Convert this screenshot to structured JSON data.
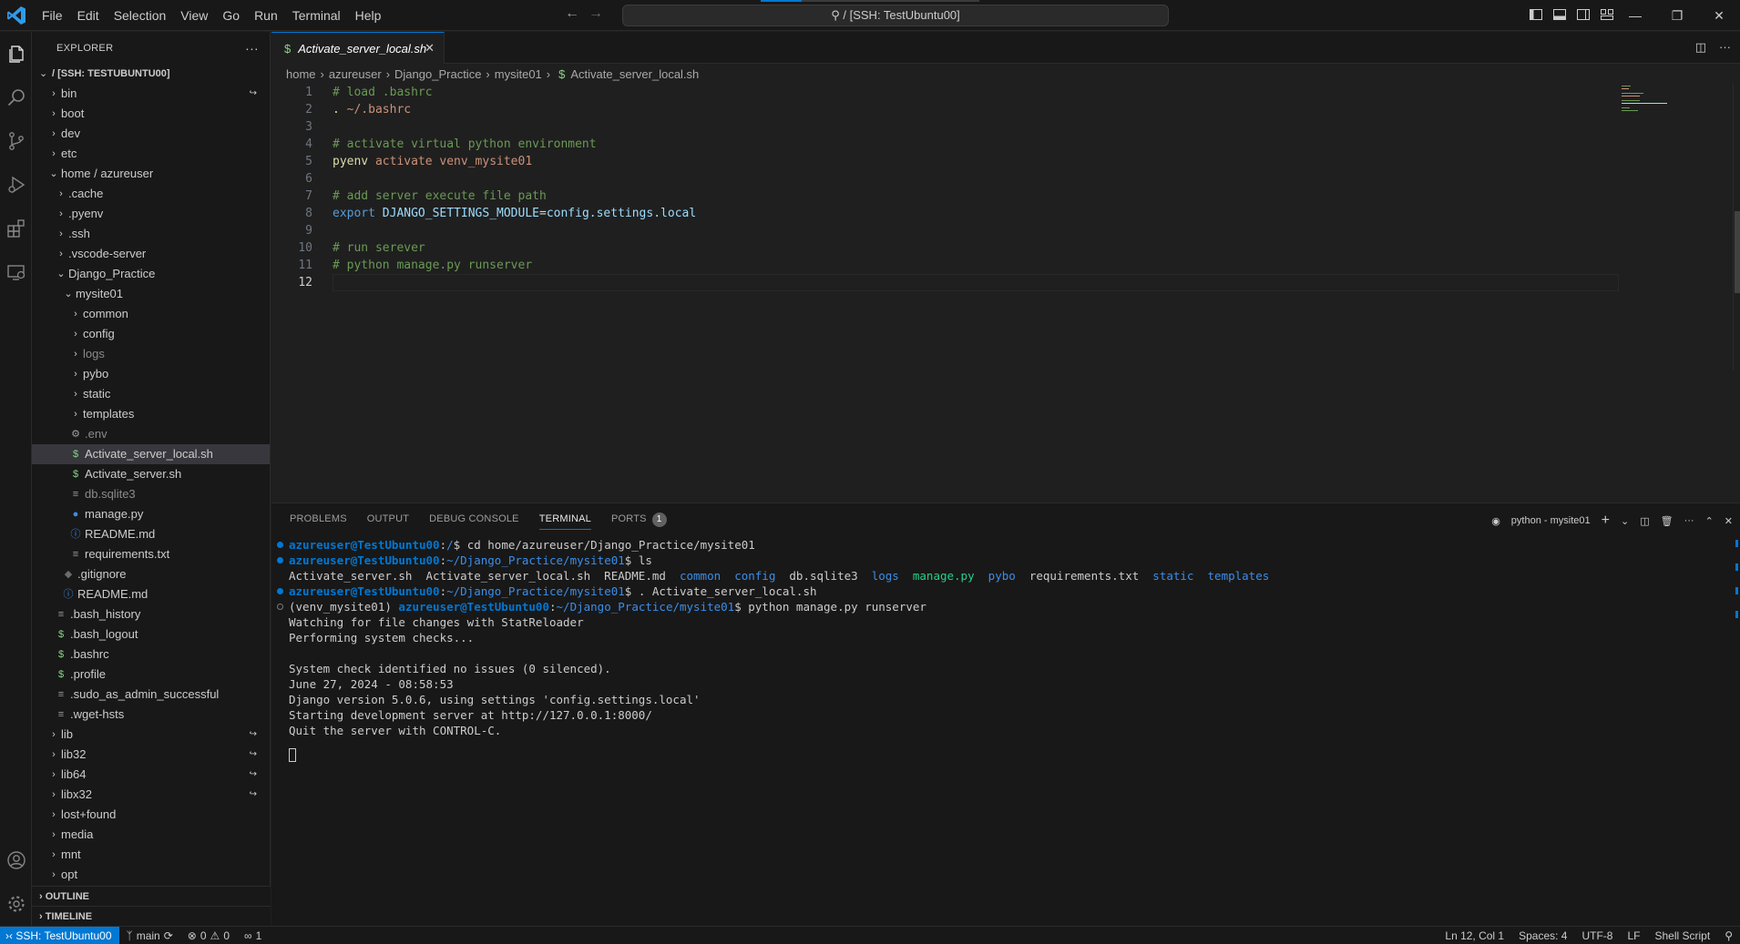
{
  "menu": [
    "File",
    "Edit",
    "Selection",
    "View",
    "Go",
    "Run",
    "Terminal",
    "Help"
  ],
  "command_center": "/ [SSH: TestUbuntu00]",
  "explorer": {
    "title": "EXPLORER",
    "root_label": "/ [SSH: TESTUBUNTU00]",
    "tree": [
      {
        "label": "bin",
        "indent": 1,
        "chev": ">",
        "link": true
      },
      {
        "label": "boot",
        "indent": 1,
        "chev": ">"
      },
      {
        "label": "dev",
        "indent": 1,
        "chev": ">"
      },
      {
        "label": "etc",
        "indent": 1,
        "chev": ">"
      },
      {
        "label": "home / azureuser",
        "indent": 1,
        "chev": "v"
      },
      {
        "label": ".cache",
        "indent": 2,
        "chev": ">"
      },
      {
        "label": ".pyenv",
        "indent": 2,
        "chev": ">"
      },
      {
        "label": ".ssh",
        "indent": 2,
        "chev": ">"
      },
      {
        "label": ".vscode-server",
        "indent": 2,
        "chev": ">"
      },
      {
        "label": "Django_Practice",
        "indent": 2,
        "chev": "v"
      },
      {
        "label": "mysite01",
        "indent": 3,
        "chev": "v"
      },
      {
        "label": "common",
        "indent": 4,
        "chev": ">"
      },
      {
        "label": "config",
        "indent": 4,
        "chev": ">"
      },
      {
        "label": "logs",
        "indent": 4,
        "chev": ">",
        "dim": true
      },
      {
        "label": "pybo",
        "indent": 4,
        "chev": ">"
      },
      {
        "label": "static",
        "indent": 4,
        "chev": ">"
      },
      {
        "label": "templates",
        "indent": 4,
        "chev": ">"
      },
      {
        "label": ".env",
        "indent": 4,
        "icon": "gear",
        "dim": true
      },
      {
        "label": "Activate_server_local.sh",
        "indent": 4,
        "icon": "dollar",
        "selected": true
      },
      {
        "label": "Activate_server.sh",
        "indent": 4,
        "icon": "dollar"
      },
      {
        "label": "db.sqlite3",
        "indent": 4,
        "icon": "lines",
        "dim": true
      },
      {
        "label": "manage.py",
        "indent": 4,
        "icon": "python"
      },
      {
        "label": "README.md",
        "indent": 4,
        "icon": "info"
      },
      {
        "label": "requirements.txt",
        "indent": 4,
        "icon": "lines"
      },
      {
        "label": ".gitignore",
        "indent": 3,
        "icon": "diamond"
      },
      {
        "label": "README.md",
        "indent": 3,
        "icon": "info"
      },
      {
        "label": ".bash_history",
        "indent": 2,
        "icon": "lines"
      },
      {
        "label": ".bash_logout",
        "indent": 2,
        "icon": "dollar"
      },
      {
        "label": ".bashrc",
        "indent": 2,
        "icon": "dollar"
      },
      {
        "label": ".profile",
        "indent": 2,
        "icon": "dollar"
      },
      {
        "label": ".sudo_as_admin_successful",
        "indent": 2,
        "icon": "lines"
      },
      {
        "label": ".wget-hsts",
        "indent": 2,
        "icon": "lines"
      },
      {
        "label": "lib",
        "indent": 1,
        "chev": ">",
        "link": true
      },
      {
        "label": "lib32",
        "indent": 1,
        "chev": ">",
        "link": true
      },
      {
        "label": "lib64",
        "indent": 1,
        "chev": ">",
        "link": true
      },
      {
        "label": "libx32",
        "indent": 1,
        "chev": ">",
        "link": true
      },
      {
        "label": "lost+found",
        "indent": 1,
        "chev": ">"
      },
      {
        "label": "media",
        "indent": 1,
        "chev": ">"
      },
      {
        "label": "mnt",
        "indent": 1,
        "chev": ">"
      },
      {
        "label": "opt",
        "indent": 1,
        "chev": ">"
      }
    ],
    "outline": "OUTLINE",
    "timeline": "TIMELINE"
  },
  "editor": {
    "tab_label": "Activate_server_local.sh",
    "breadcrumb": [
      "home",
      "azureuser",
      "Django_Practice",
      "mysite01",
      "Activate_server_local.sh"
    ],
    "lines": [
      {
        "n": "1",
        "parts": [
          [
            "c-comment",
            "# load .bashrc"
          ]
        ]
      },
      {
        "n": "2",
        "parts": [
          [
            "c-cmd",
            "."
          ],
          [
            "c-plain",
            " "
          ],
          [
            "c-str",
            "~/.bashrc"
          ]
        ]
      },
      {
        "n": "3",
        "parts": []
      },
      {
        "n": "4",
        "parts": [
          [
            "c-comment",
            "# activate virtual python environment"
          ]
        ]
      },
      {
        "n": "5",
        "parts": [
          [
            "c-cmd",
            "pyenv"
          ],
          [
            "c-plain",
            " "
          ],
          [
            "c-str",
            "activate venv_mysite01"
          ]
        ]
      },
      {
        "n": "6",
        "parts": []
      },
      {
        "n": "7",
        "parts": [
          [
            "c-comment",
            "# add server execute file path"
          ]
        ]
      },
      {
        "n": "8",
        "parts": [
          [
            "c-kw",
            "export"
          ],
          [
            "c-plain",
            " "
          ],
          [
            "c-var",
            "DJANGO_SETTINGS_MODULE"
          ],
          [
            "c-plain",
            "="
          ],
          [
            "c-var",
            "config.settings.local"
          ]
        ]
      },
      {
        "n": "9",
        "parts": []
      },
      {
        "n": "10",
        "parts": [
          [
            "c-comment",
            "# run serever"
          ]
        ]
      },
      {
        "n": "11",
        "parts": [
          [
            "c-comment",
            "# python manage.py runserver"
          ]
        ]
      },
      {
        "n": "12",
        "parts": [],
        "current": true
      }
    ]
  },
  "panel": {
    "tabs": [
      "PROBLEMS",
      "OUTPUT",
      "DEBUG CONSOLE",
      "TERMINAL",
      "PORTS"
    ],
    "active_tab": "TERMINAL",
    "ports_badge": "1",
    "terminal_name": "python - mysite01",
    "terminal": [
      {
        "dot": "blue",
        "parts": [
          [
            "t-user",
            "azureuser@TestUbuntu00"
          ],
          [
            "t-def",
            ":"
          ],
          [
            "t-usr2",
            "/"
          ],
          [
            "t-def",
            "$ cd home/azureuser/Django_Practice/mysite01"
          ]
        ]
      },
      {
        "dot": "blue",
        "parts": [
          [
            "t-user",
            "azureuser@TestUbuntu00"
          ],
          [
            "t-def",
            ":"
          ],
          [
            "t-usr2",
            "~/Django_Practice/mysite01"
          ],
          [
            "t-def",
            "$ ls"
          ]
        ]
      },
      {
        "dot": "",
        "parts": [
          [
            "t-def",
            "Activate_server.sh  Activate_server_local.sh  README.md  "
          ],
          [
            "t-dir",
            "common"
          ],
          [
            "t-def",
            "  "
          ],
          [
            "t-dir",
            "config"
          ],
          [
            "t-def",
            "  db.sqlite3  "
          ],
          [
            "t-dir",
            "logs"
          ],
          [
            "t-def",
            "  "
          ],
          [
            "t-exe",
            "manage.py"
          ],
          [
            "t-def",
            "  "
          ],
          [
            "t-dir",
            "pybo"
          ],
          [
            "t-def",
            "  requirements.txt  "
          ],
          [
            "t-dir",
            "static"
          ],
          [
            "t-def",
            "  "
          ],
          [
            "t-dir",
            "templates"
          ]
        ]
      },
      {
        "dot": "blue",
        "parts": [
          [
            "t-user",
            "azureuser@TestUbuntu00"
          ],
          [
            "t-def",
            ":"
          ],
          [
            "t-usr2",
            "~/Django_Practice/mysite01"
          ],
          [
            "t-def",
            "$ . Activate_server_local.sh"
          ]
        ]
      },
      {
        "dot": "hollow",
        "parts": [
          [
            "t-def",
            "(venv_mysite01) "
          ],
          [
            "t-user",
            "azureuser@TestUbuntu00"
          ],
          [
            "t-def",
            ":"
          ],
          [
            "t-usr2",
            "~/Django_Practice/mysite01"
          ],
          [
            "t-def",
            "$ python manage.py runserver"
          ]
        ]
      },
      {
        "dot": "",
        "parts": [
          [
            "t-def",
            "Watching for file changes with StatReloader"
          ]
        ]
      },
      {
        "dot": "",
        "parts": [
          [
            "t-def",
            "Performing system checks..."
          ]
        ]
      },
      {
        "dot": "",
        "parts": [
          [
            "t-def",
            ""
          ]
        ]
      },
      {
        "dot": "",
        "parts": [
          [
            "t-def",
            "System check identified no issues (0 silenced)."
          ]
        ]
      },
      {
        "dot": "",
        "parts": [
          [
            "t-def",
            "June 27, 2024 - 08:58:53"
          ]
        ]
      },
      {
        "dot": "",
        "parts": [
          [
            "t-def",
            "Django version 5.0.6, using settings 'config.settings.local'"
          ]
        ]
      },
      {
        "dot": "",
        "parts": [
          [
            "t-def",
            "Starting development server at http://127.0.0.1:8000/"
          ]
        ]
      },
      {
        "dot": "",
        "parts": [
          [
            "t-def",
            "Quit the server with CONTROL-C."
          ]
        ]
      }
    ]
  },
  "status": {
    "remote": "SSH: TestUbuntu00",
    "branch": "main",
    "errors": "0",
    "warnings": "0",
    "ports": "1",
    "position": "Ln 12, Col 1",
    "spaces": "Spaces: 4",
    "encoding": "UTF-8",
    "eol": "LF",
    "language": "Shell Script"
  },
  "colors": {
    "accent": "#0078d4",
    "bg": "#1f1f1f",
    "sidebar": "#181818"
  }
}
